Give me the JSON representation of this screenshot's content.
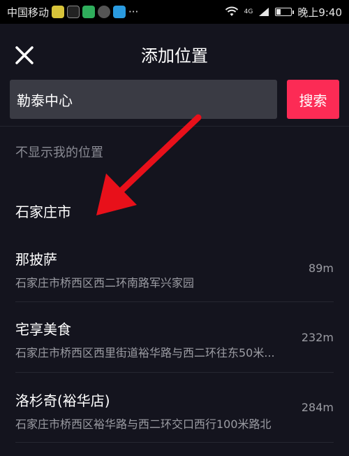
{
  "status_bar": {
    "carrier": "中国移动",
    "dots": "···",
    "network": "4G",
    "time": "晚上9:40",
    "battery_level": 0.3
  },
  "header": {
    "title": "添加位置",
    "close_icon": "close-icon"
  },
  "search": {
    "value": "勒泰中心",
    "button_label": "搜索"
  },
  "no_location_label": "不显示我的位置",
  "results": [
    {
      "name": "石家庄市",
      "address": "",
      "distance": ""
    },
    {
      "name": "那披萨",
      "address": "石家庄市桥西区西二环南路军兴家园",
      "distance": "89m"
    },
    {
      "name": "宅享美食",
      "address": "石家庄市桥西区西里街道裕华路与西二环往东50米...",
      "distance": "232m"
    },
    {
      "name": "洛杉奇(裕华店)",
      "address": "石家庄市桥西区裕华路与西二环交口西行100米路北",
      "distance": "284m"
    }
  ],
  "colors": {
    "background": "#14141e",
    "accent": "#fc2b55",
    "annotation_arrow": "#e8101a"
  }
}
